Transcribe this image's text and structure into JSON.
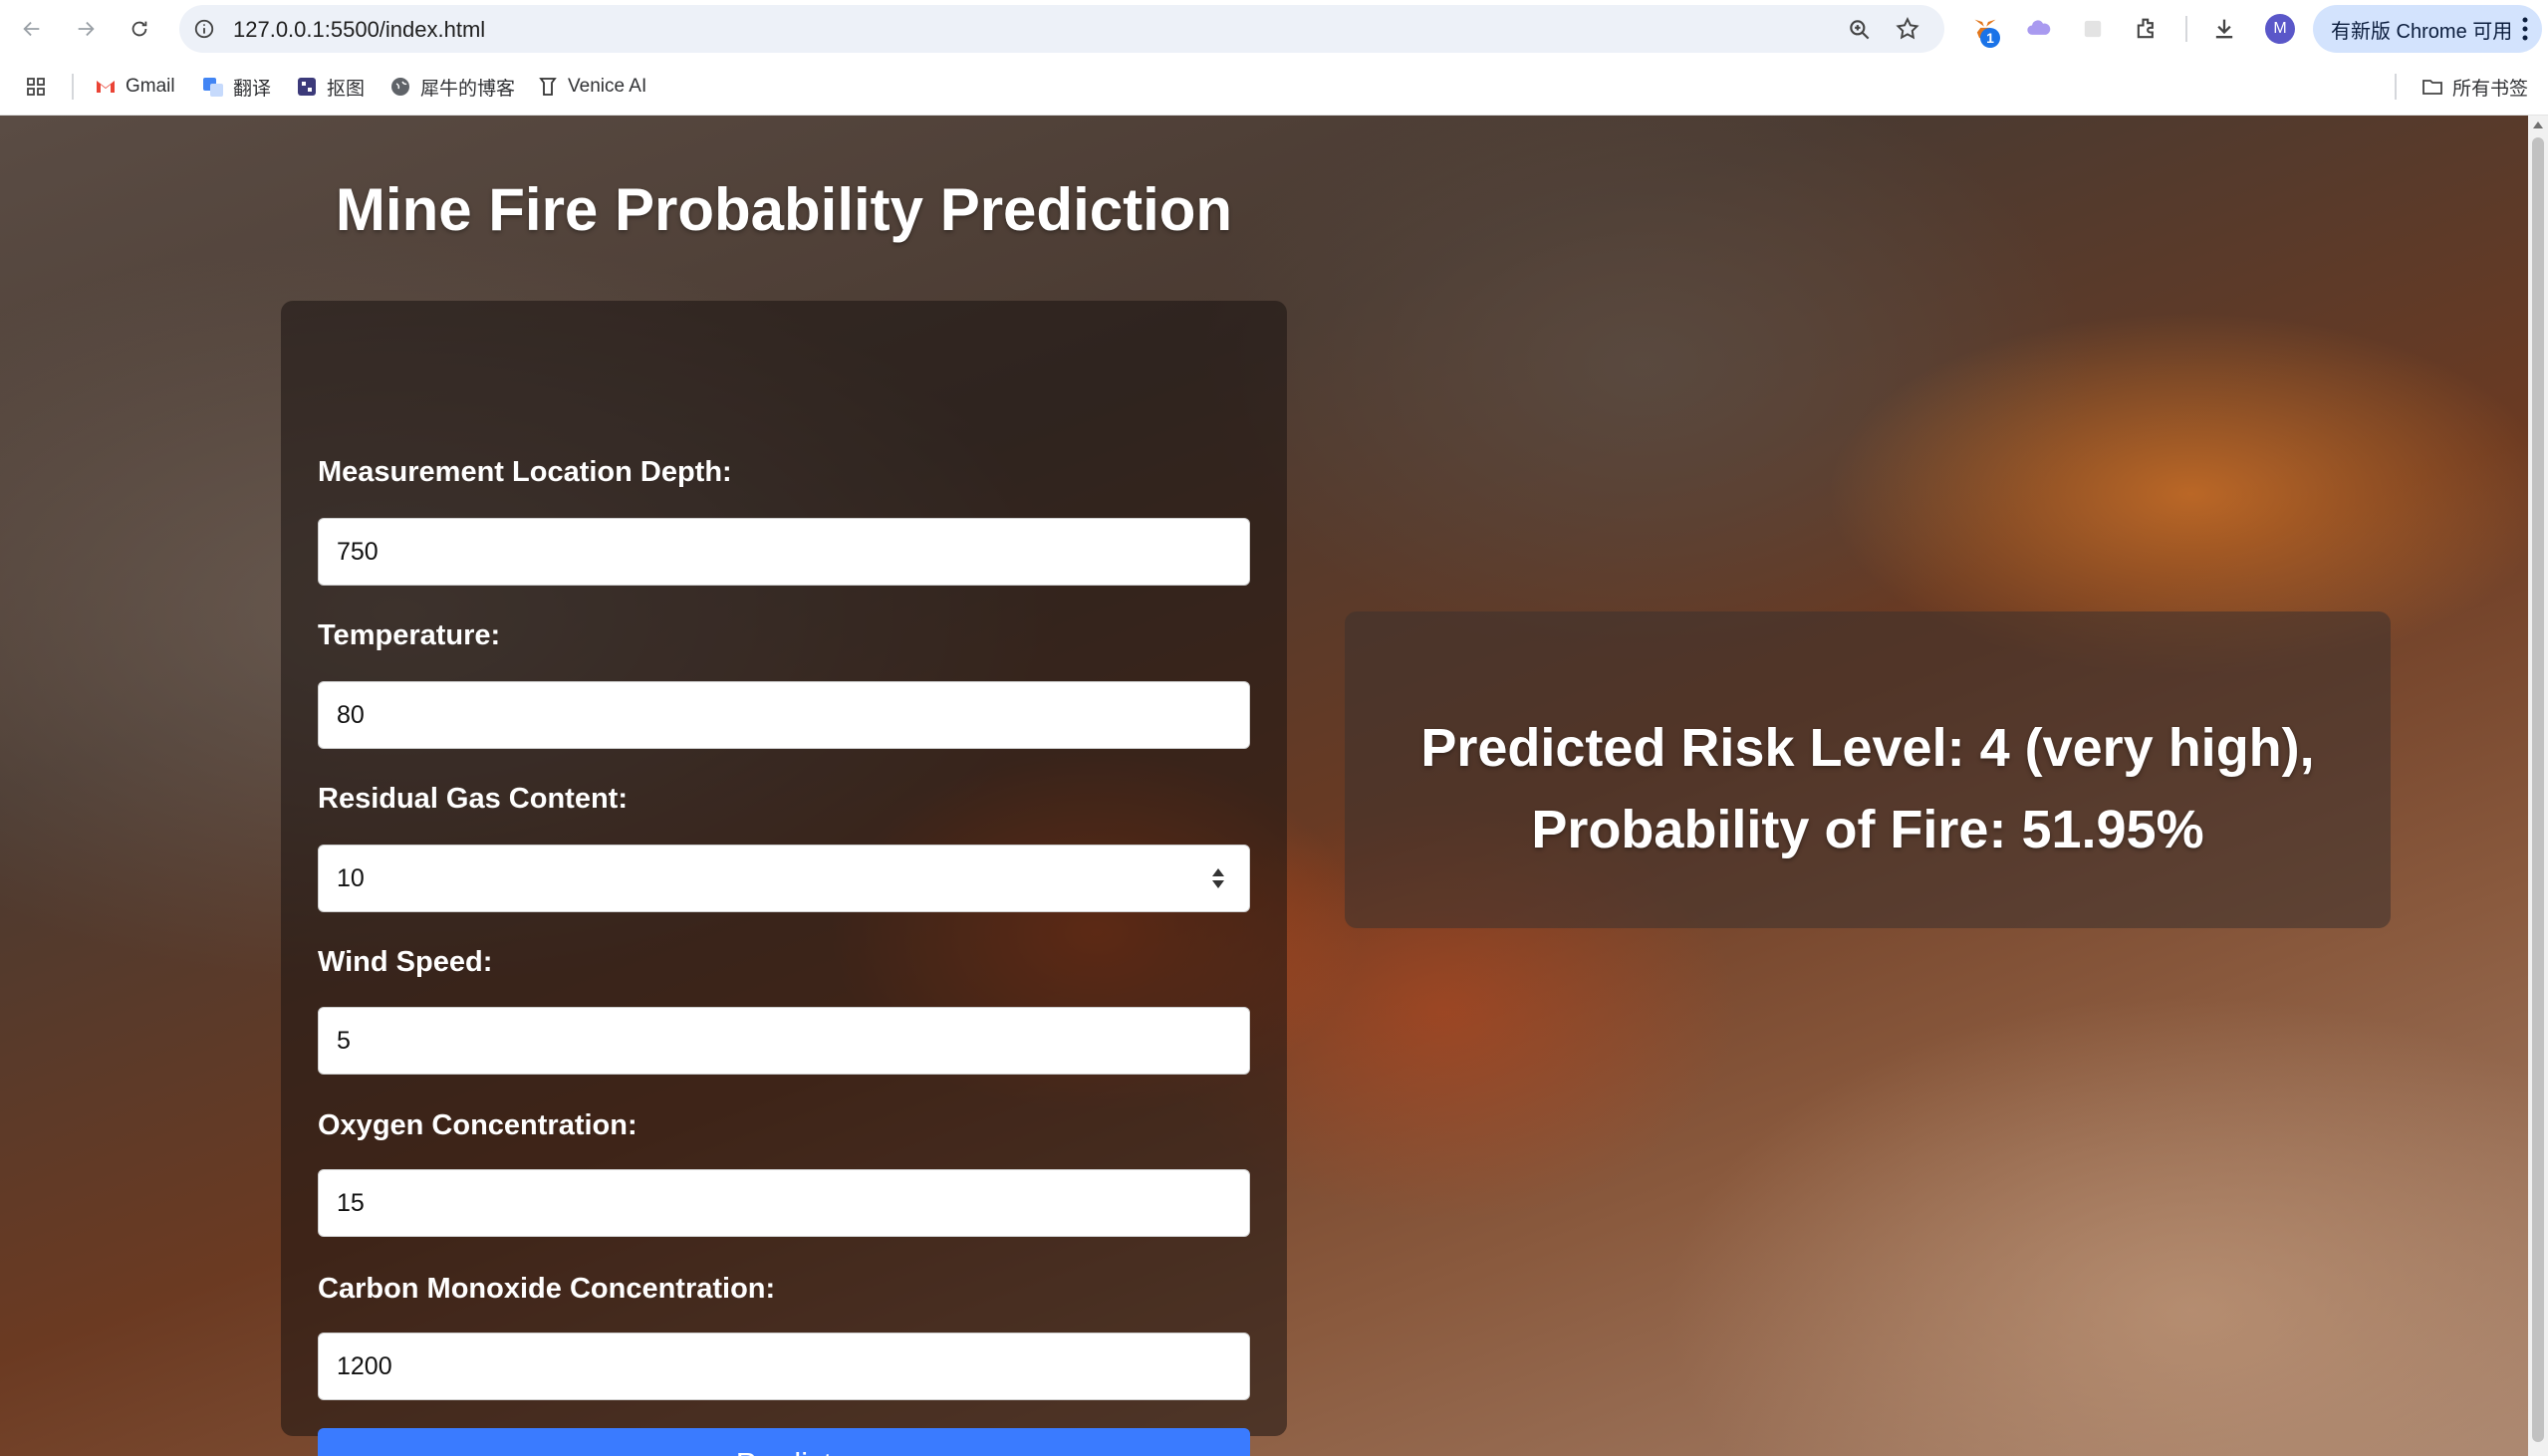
{
  "browser": {
    "url": "127.0.0.1:5500/index.html",
    "update_label": "有新版 Chrome 可用",
    "avatar_initial": "M",
    "extension_badge": "1",
    "bookmarks": [
      {
        "label": "Gmail",
        "icon": "gmail-icon"
      },
      {
        "label": "翻译",
        "icon": "translate-icon"
      },
      {
        "label": "抠图",
        "icon": "cutout-icon"
      },
      {
        "label": "犀牛的博客",
        "icon": "globe-icon"
      },
      {
        "label": "Venice AI",
        "icon": "venice-icon"
      }
    ],
    "all_bookmarks_label": "所有书签"
  },
  "page": {
    "title": "Mine Fire Probability Prediction",
    "fields": [
      {
        "label": "Measurement Location Depth:",
        "value": "750"
      },
      {
        "label": "Temperature:",
        "value": "80"
      },
      {
        "label": "Residual Gas Content:",
        "value": "10"
      },
      {
        "label": "Wind Speed:",
        "value": "5"
      },
      {
        "label": "Oxygen Concentration:",
        "value": "15"
      },
      {
        "label": "Carbon Monoxide Concentration:",
        "value": "1200"
      }
    ],
    "predict_label": "Predict",
    "result": {
      "line1": "Predicted Risk Level: 4 (very high),",
      "line2": "Probability of Fire: 51.95%"
    }
  },
  "colors": {
    "button": "#3a7bff",
    "omnibox": "#edf1f8",
    "update_button": "#d3e3fd"
  }
}
